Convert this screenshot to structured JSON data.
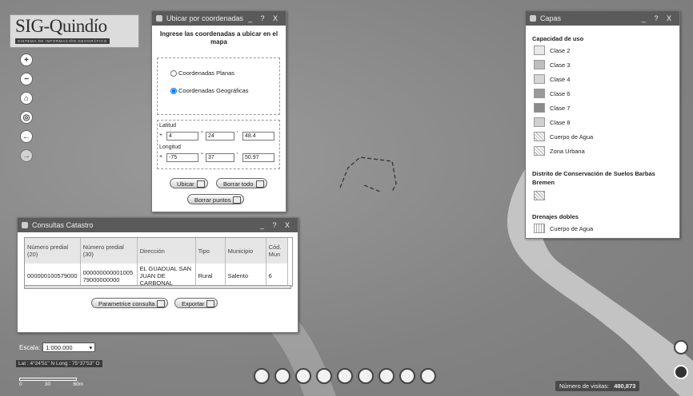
{
  "logo": {
    "title": "SIG-Quindío",
    "subtitle": "Sistema de Información Geográfico"
  },
  "coord_panel": {
    "title": "Ubicar por coordenadas",
    "controls": "_ ? X",
    "heading": "Ingrese las coordenadas a ubicar en el mapa",
    "option_planas": "Coordenadas Planas",
    "option_geo": "Coordenadas Geográficas",
    "selected": "Coordenadas Geográficas",
    "lat_label": "Latitud",
    "lat_sign": "+",
    "lat": [
      "4",
      "24",
      "48.4"
    ],
    "lon_label": "Longitud",
    "lon_sign": "+",
    "lon": [
      "-75",
      "37",
      "50.97"
    ],
    "unit_deg": "°",
    "unit_min": "'",
    "unit_sec": "\"",
    "btn_ubicar": "Ubicar",
    "btn_borrar_todo": "Borrar todo",
    "btn_borrar_puntos": "Borrar puntos"
  },
  "layers_panel": {
    "title": "Capas",
    "controls": "_ ? X",
    "group1": "Capacidad de uso",
    "items1": [
      "Clase 2",
      "Clase 3",
      "Clase 4",
      "Clase 6",
      "Clase 7",
      "Clase 8",
      "Cuerpo de Agua",
      "Zona Urbana"
    ],
    "colors1": [
      "#e8e8e8",
      "#bdbdbd",
      "#d6d6d6",
      "#9a9a9a",
      "#8a8a8a",
      "#d0d0d0",
      "#f4f4f4",
      "#f4f4f4"
    ],
    "group2": "Distrito de Conservación de Suelos Barbas Bremen",
    "group3": "Drenajes dobles",
    "items3": [
      "Cuerpo de Agua"
    ]
  },
  "cadastral_panel": {
    "title": "Consultas Catastro",
    "controls": "_ ? X",
    "headers": [
      "Número predial (20)",
      "Número predial (30)",
      "Dirección",
      "Tipo",
      "Municipio",
      "Cód. Mun"
    ],
    "row": [
      "000000100579000",
      "000000000001005 79000000000",
      "EL GUADUAL SAN JUAN DE CARBONAL",
      "Rural",
      "Salento",
      "6"
    ],
    "btn_parametrice": "Parametrice consulta",
    "btn_exportar": "Exportar"
  },
  "scale": {
    "label": "Escala:",
    "value": "1:000.000"
  },
  "coords_readout": "Lat : 4°24'51\" N  Long : 75°37'53\" O",
  "scalebar": [
    "0",
    "30",
    "60m"
  ],
  "visits": {
    "label": "Número de visitas:",
    "value": "480,873"
  }
}
